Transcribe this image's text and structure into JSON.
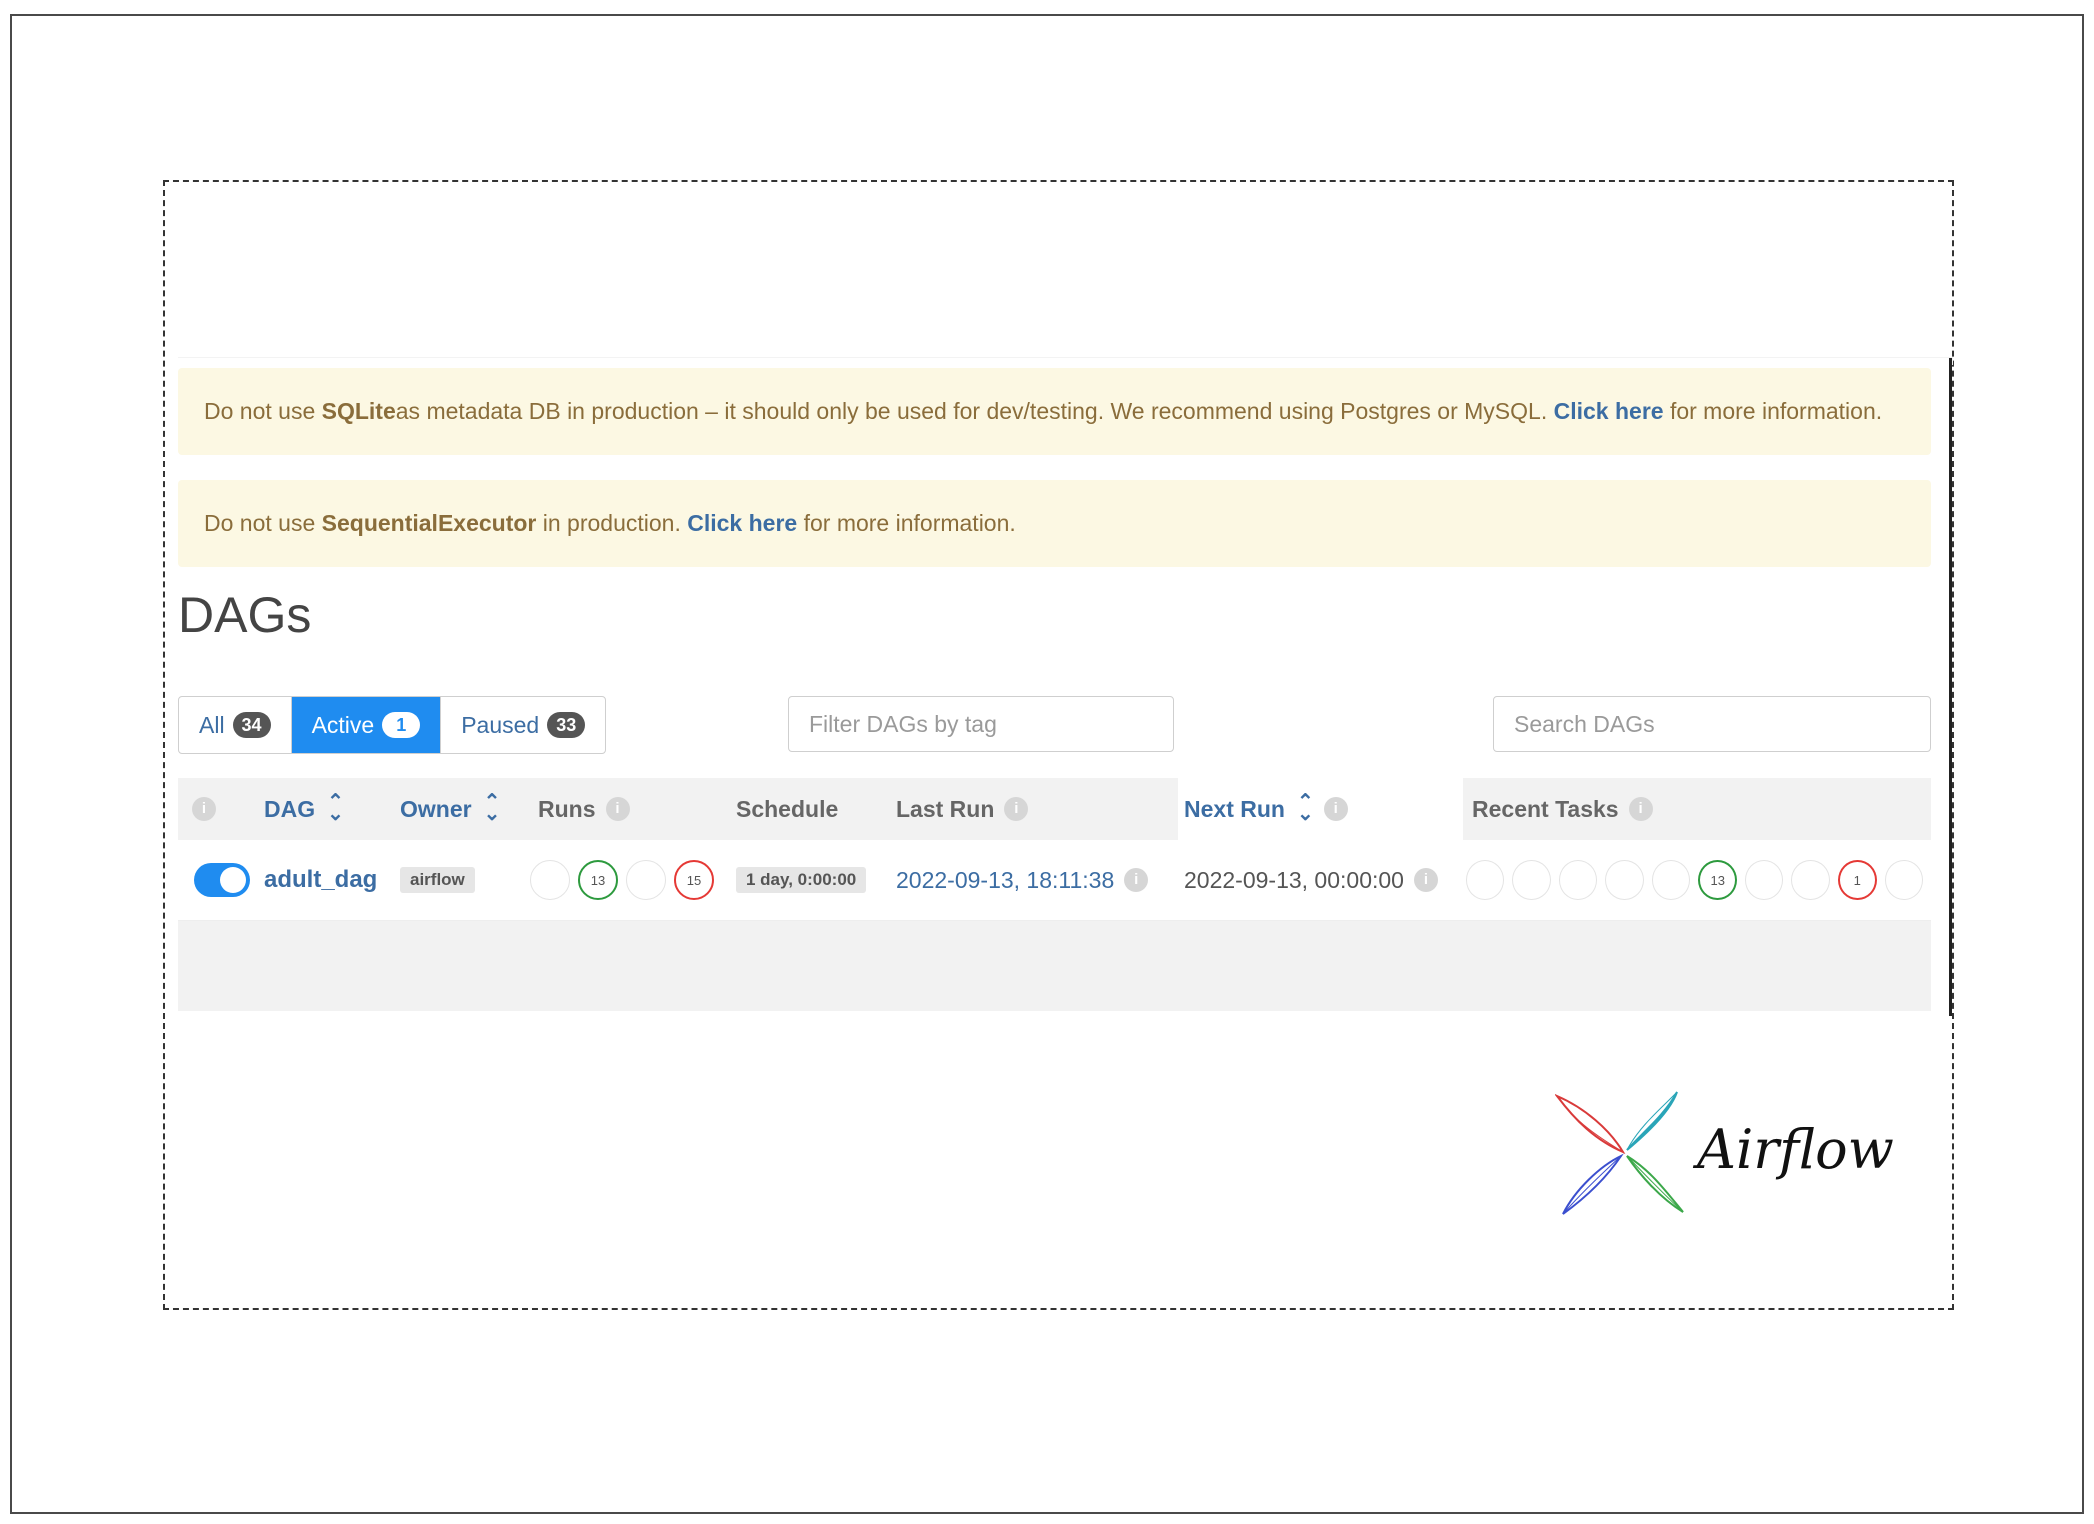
{
  "alerts": [
    {
      "pre": "Do not use ",
      "strong": "SQLite",
      "mid": " as metadata DB in production – it should only be used for dev/testing. We recommend using Postgres or MySQL. ",
      "link": "Click here",
      "post": " for more information."
    },
    {
      "pre": "Do not use ",
      "strong": "SequentialExecutor",
      "mid": " in production. ",
      "link": "Click here",
      "post": " for more information."
    }
  ],
  "page_title": "DAGs",
  "status_filter": [
    {
      "label": "All",
      "count": "34"
    },
    {
      "label": "Active",
      "count": "1"
    },
    {
      "label": "Paused",
      "count": "33"
    }
  ],
  "tag_filter": {
    "placeholder": "Filter DAGs by tag"
  },
  "search": {
    "placeholder": "Search DAGs"
  },
  "table": {
    "headers": {
      "dag": "DAG",
      "owner": "Owner",
      "runs": "Runs",
      "schedule": "Schedule",
      "last_run": "Last Run",
      "next_run": "Next Run",
      "recent_tasks": "Recent Tasks"
    },
    "rows": [
      {
        "dag_id": "adult_dag",
        "owner": "airflow",
        "runs": [
          {
            "count": "",
            "state": "empty"
          },
          {
            "count": "13",
            "state": "success"
          },
          {
            "count": "",
            "state": "empty"
          },
          {
            "count": "15",
            "state": "failed"
          }
        ],
        "schedule": "1 day, 0:00:00",
        "last_run": "2022-09-13, 18:11:38",
        "next_run": "2022-09-13, 00:00:00",
        "recent_tasks": [
          {
            "count": "",
            "state": "empty"
          },
          {
            "count": "",
            "state": "empty"
          },
          {
            "count": "",
            "state": "empty"
          },
          {
            "count": "",
            "state": "empty"
          },
          {
            "count": "",
            "state": "empty"
          },
          {
            "count": "13",
            "state": "success"
          },
          {
            "count": "",
            "state": "empty"
          },
          {
            "count": "",
            "state": "empty"
          },
          {
            "count": "1",
            "state": "failed"
          },
          {
            "count": "",
            "state": "empty"
          }
        ]
      }
    ]
  },
  "logo_text": "Airflow",
  "colors": {
    "accent": "#1f8cf0",
    "link": "#3c6da3",
    "alert_bg": "#fcf8e3",
    "alert_text": "#8a6d3b",
    "success": "#2d9a3e",
    "failed": "#e53935"
  }
}
